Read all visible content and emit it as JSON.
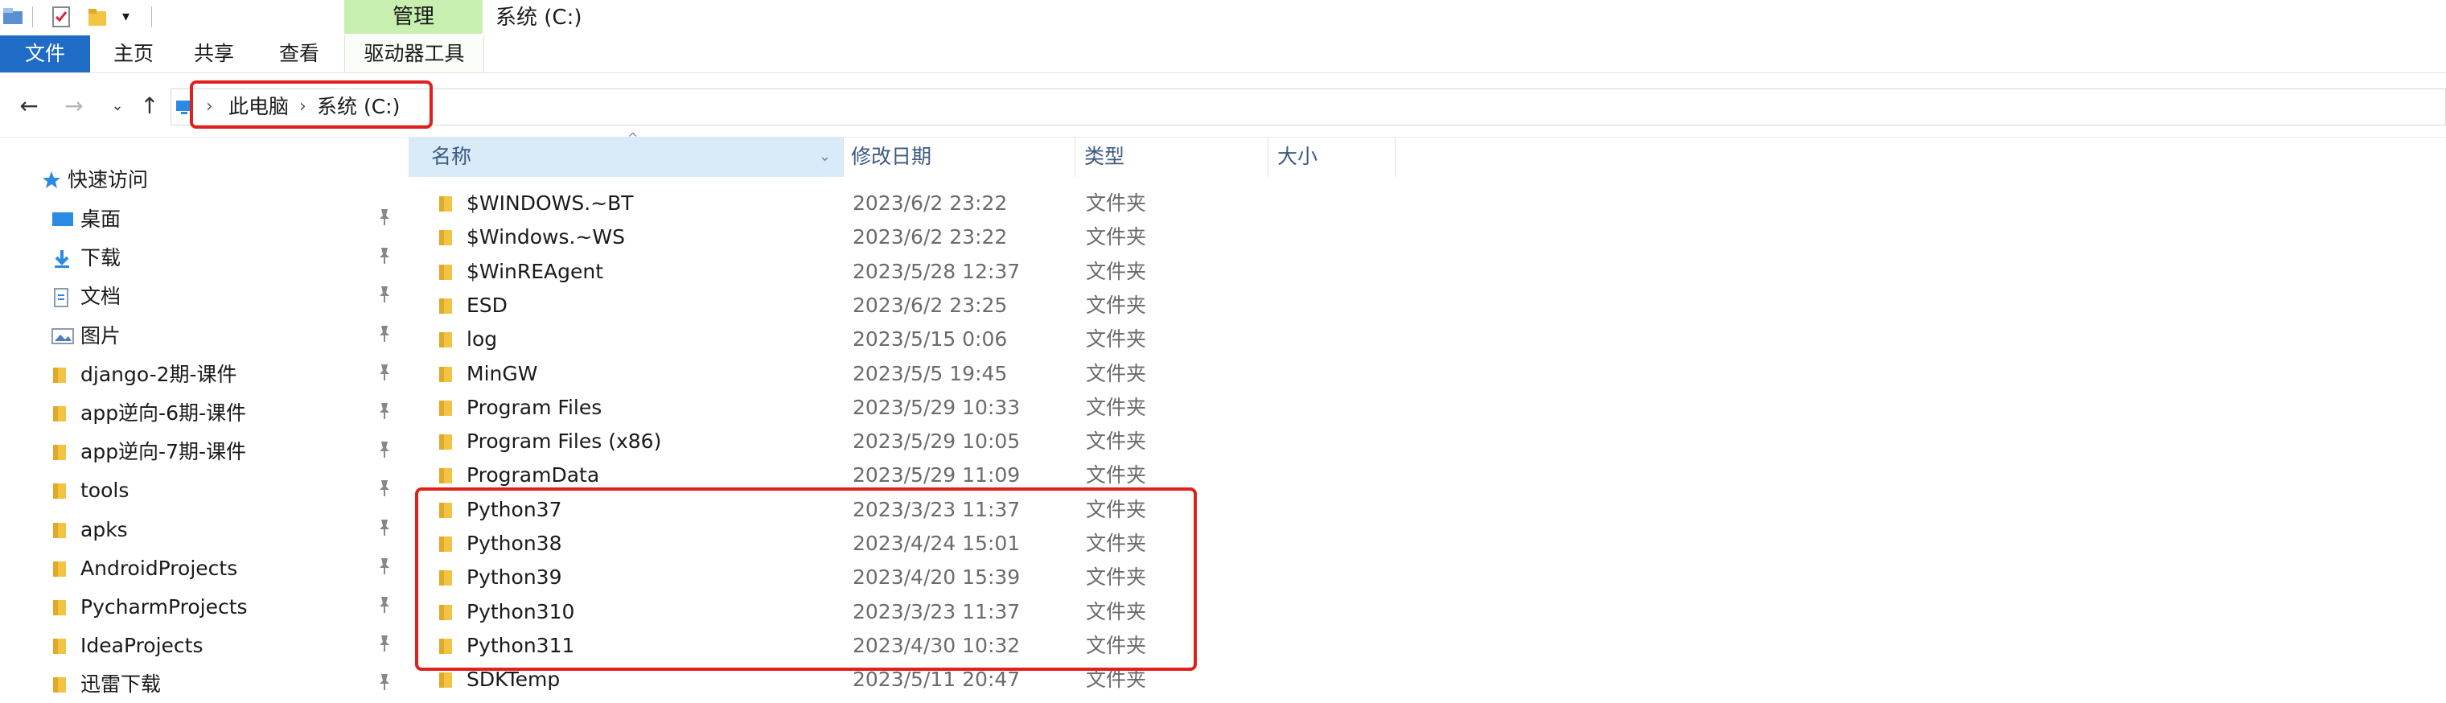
{
  "window": {
    "title": "系统 (C:)",
    "context_tab": "管理"
  },
  "ribbon": {
    "tabs": [
      "文件",
      "主页",
      "共享",
      "查看"
    ],
    "context_tool": "驱动器工具"
  },
  "address": {
    "crumbs": [
      "此电脑",
      "系统 (C:)"
    ],
    "separator": "›"
  },
  "sidebar": {
    "quick_access": "快速访问",
    "items": [
      {
        "label": "桌面",
        "icon": "desktop-icon",
        "color": "#2b8ae3"
      },
      {
        "label": "下载",
        "icon": "download-icon",
        "color": "#2b8ae3"
      },
      {
        "label": "文档",
        "icon": "document-icon",
        "color": "#8a9bb0"
      },
      {
        "label": "图片",
        "icon": "picture-icon",
        "color": "#8a9bb0"
      },
      {
        "label": "django-2期-课件",
        "icon": "folder-icon",
        "color": "#f3c343"
      },
      {
        "label": "app逆向-6期-课件",
        "icon": "folder-icon",
        "color": "#f3c343"
      },
      {
        "label": "app逆向-7期-课件",
        "icon": "folder-icon",
        "color": "#f3c343"
      },
      {
        "label": "tools",
        "icon": "folder-icon",
        "color": "#f3c343"
      },
      {
        "label": "apks",
        "icon": "folder-icon",
        "color": "#f3c343"
      },
      {
        "label": "AndroidProjects",
        "icon": "folder-icon",
        "color": "#f3c343"
      },
      {
        "label": "PycharmProjects",
        "icon": "folder-icon",
        "color": "#f3c343"
      },
      {
        "label": "IdeaProjects",
        "icon": "folder-icon",
        "color": "#f3c343"
      },
      {
        "label": "迅雷下载",
        "icon": "folder-icon",
        "color": "#f3c343"
      }
    ]
  },
  "columns": {
    "name": "名称",
    "date": "修改日期",
    "type": "类型",
    "size": "大小"
  },
  "files": [
    {
      "name": "$WINDOWS.~BT",
      "date": "2023/6/2 23:22",
      "type": "文件夹"
    },
    {
      "name": "$Windows.~WS",
      "date": "2023/6/2 23:22",
      "type": "文件夹"
    },
    {
      "name": "$WinREAgent",
      "date": "2023/5/28 12:37",
      "type": "文件夹"
    },
    {
      "name": "ESD",
      "date": "2023/6/2 23:25",
      "type": "文件夹"
    },
    {
      "name": "log",
      "date": "2023/5/15 0:06",
      "type": "文件夹"
    },
    {
      "name": "MinGW",
      "date": "2023/5/5 19:45",
      "type": "文件夹"
    },
    {
      "name": "Program Files",
      "date": "2023/5/29 10:33",
      "type": "文件夹"
    },
    {
      "name": "Program Files (x86)",
      "date": "2023/5/29 10:05",
      "type": "文件夹"
    },
    {
      "name": "ProgramData",
      "date": "2023/5/29 11:09",
      "type": "文件夹"
    },
    {
      "name": "Python37",
      "date": "2023/3/23 11:37",
      "type": "文件夹"
    },
    {
      "name": "Python38",
      "date": "2023/4/24 15:01",
      "type": "文件夹"
    },
    {
      "name": "Python39",
      "date": "2023/4/20 15:39",
      "type": "文件夹"
    },
    {
      "name": "Python310",
      "date": "2023/3/23 11:37",
      "type": "文件夹"
    },
    {
      "name": "Python311",
      "date": "2023/4/30 10:32",
      "type": "文件夹"
    },
    {
      "name": "SDKTemp",
      "date": "2023/5/11 20:47",
      "type": "文件夹"
    }
  ],
  "colors": {
    "accent": "#1f6cc7",
    "context_tab": "#c6efb0",
    "highlight": "#e0201b",
    "folder": "#f3c343"
  }
}
